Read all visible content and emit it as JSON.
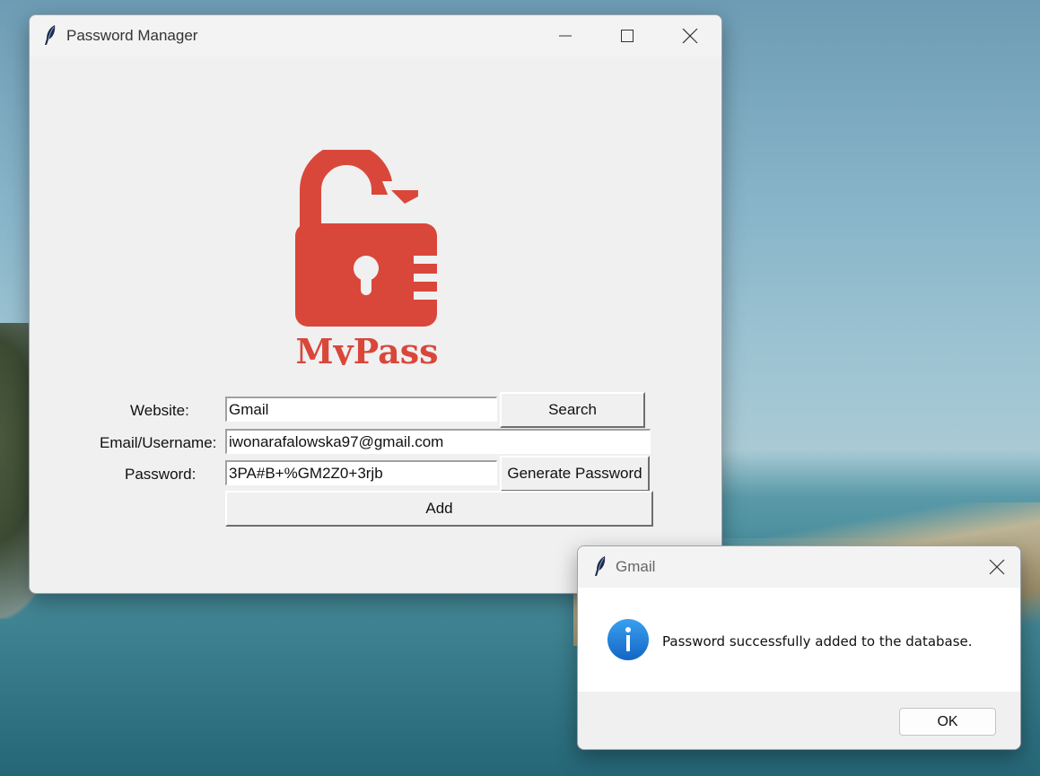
{
  "main_window": {
    "title": "Password Manager",
    "logo_text": "MyPass",
    "form": {
      "website_label": "Website:",
      "website_value": "Gmail",
      "search_label": "Search",
      "email_label": "Email/Username:",
      "email_value": "iwonarafalowska97@gmail.com",
      "password_label": "Password:",
      "password_value": "3PA#B+%GM2Z0+3rjb",
      "generate_label": "Generate Password",
      "add_label": "Add"
    }
  },
  "dialog": {
    "title": "Gmail",
    "message": "Password successfully added to the database.",
    "ok_label": "OK",
    "icon": "info-icon"
  },
  "colors": {
    "logo_red": "#d9473b",
    "info_blue": "#1f7ad8"
  }
}
